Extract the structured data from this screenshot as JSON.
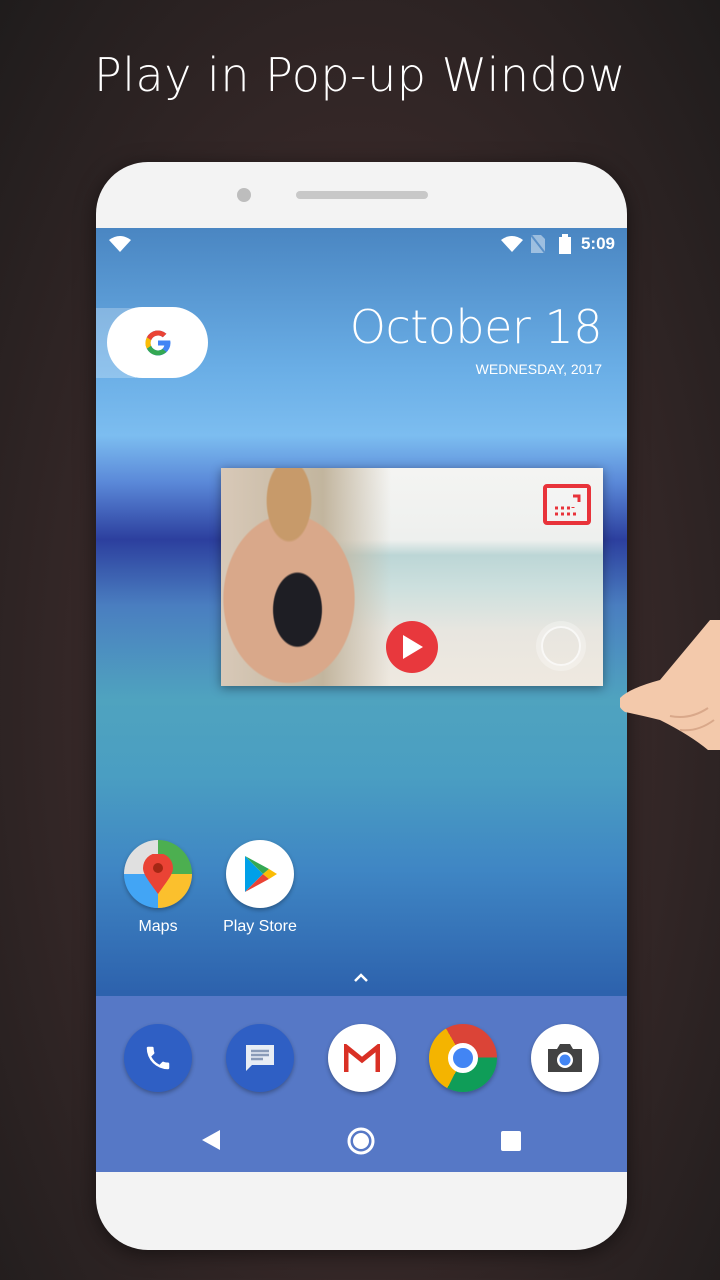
{
  "title": "Play in Pop-up Window",
  "status_bar": {
    "time": "5:09",
    "icons": [
      "wifi-icon",
      "no-sim-icon",
      "battery-icon"
    ]
  },
  "widget": {
    "date": "October 18",
    "day_year": "WEDNESDAY, 2017"
  },
  "popup_player": {
    "controls": [
      "fullscreen-icon",
      "play-icon"
    ],
    "accent": "#e8383d"
  },
  "apps": [
    {
      "label": "Maps"
    },
    {
      "label": "Play Store"
    }
  ],
  "dock": [
    "phone-icon",
    "messages-icon",
    "gmail-icon",
    "chrome-icon",
    "camera-icon"
  ],
  "nav": [
    "back-icon",
    "home-icon",
    "recents-icon"
  ]
}
